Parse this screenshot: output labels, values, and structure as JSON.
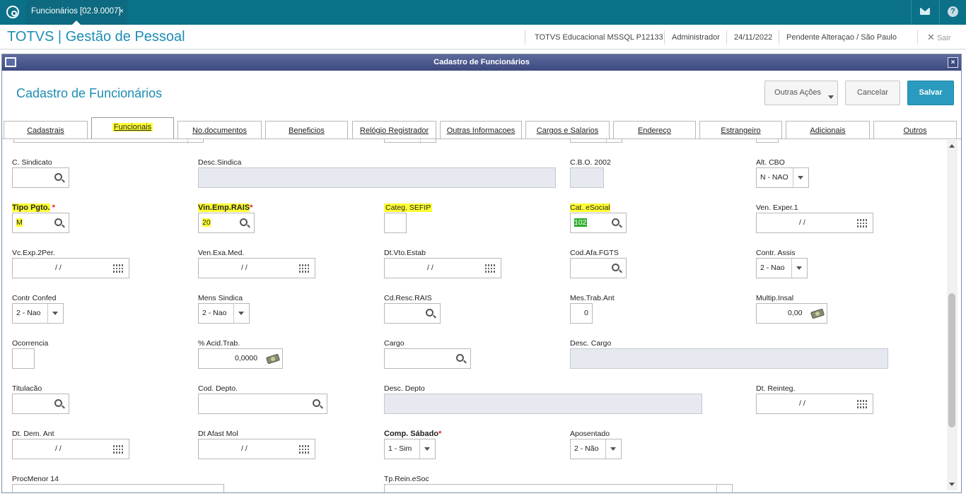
{
  "topbar": {
    "tab_label": "Funcionários [02.9.0007]",
    "tab_close": "×",
    "mail_icon": "mail-icon",
    "help_label": "?"
  },
  "header": {
    "app_title": "TOTVS | Gestão de Pessoal",
    "environment": "TOTVS Educacional MSSQL P12133",
    "user": "Administrador",
    "date": "24/11/2022",
    "status": "Pendente Alteraçao / São Paulo",
    "logout": "Sair"
  },
  "window": {
    "title": "Cadastro de Funcionários",
    "close": "×"
  },
  "form": {
    "title": "Cadastro de Funcionários",
    "actions": {
      "other": "Outras Ações",
      "cancel": "Cancelar",
      "save": "Salvar"
    }
  },
  "tabs": [
    "Cadastrais",
    "Funcionais",
    "No.documentos",
    "Beneficios",
    "Relógio Registrador",
    "Outras Informacoes",
    "Cargos e Salarios",
    "Endereço",
    "Estrangeiro",
    "Adicionais",
    "Outros"
  ],
  "fields": {
    "c_sindicato": {
      "label": "C. Sindicato"
    },
    "desc_sindica": {
      "label": "Desc.Sindica"
    },
    "cbo": {
      "label": "C.B.O. 2002"
    },
    "alt_cbo": {
      "label": "Alt. CBO",
      "value": "N - NAO"
    },
    "tipo_pgto": {
      "label": "Tipo Pgto.",
      "req": "*",
      "value": "M"
    },
    "vin_emp_rais": {
      "label": "Vin.Emp.RAIS",
      "req": "*",
      "value": "20"
    },
    "categ_sefip": {
      "label": "Categ. SEFIP"
    },
    "cat_esocial": {
      "label": "Cat. eSocial",
      "value": "102"
    },
    "ven_exper1": {
      "label": "Ven. Exper.1",
      "value": "/ /"
    },
    "vc_exp_2per": {
      "label": "Vc.Exp.2Per.",
      "value": "/ /"
    },
    "ven_exa_med": {
      "label": "Ven.Exa.Med.",
      "value": "/ /"
    },
    "dt_vto_estab": {
      "label": "Dt.Vto.Estab",
      "value": "/ /"
    },
    "cod_afa_fgts": {
      "label": "Cod.Afa.FGTS"
    },
    "contr_assis": {
      "label": "Contr. Assis",
      "value": "2 - Nao"
    },
    "contr_confed": {
      "label": "Contr Confed",
      "value": "2 - Nao"
    },
    "mens_sindica": {
      "label": "Mens Sindica",
      "value": "2 - Nao"
    },
    "cd_resc_rais": {
      "label": "Cd.Resc.RAIS"
    },
    "mes_trab_ant": {
      "label": "Mes.Trab.Ant",
      "value": "0"
    },
    "multip_insal": {
      "label": "Multip.Insal",
      "value": "0,00"
    },
    "ocorrencia": {
      "label": "Ocorrencia"
    },
    "acid_trab": {
      "label": "% Acid.Trab.",
      "value": "0,0000"
    },
    "cargo": {
      "label": "Cargo"
    },
    "desc_cargo": {
      "label": "Desc. Cargo"
    },
    "titulacao": {
      "label": "Titulacão"
    },
    "cod_depto": {
      "label": "Cod. Depto."
    },
    "desc_depto": {
      "label": "Desc. Depto"
    },
    "dt_reinteg": {
      "label": "Dt. Reinteg.",
      "value": "/ /"
    },
    "dt_dem_ant": {
      "label": "Dt. Dem. Ant",
      "value": "/ /"
    },
    "dt_afast_mol": {
      "label": "Dt Afast Mol",
      "value": "/ /"
    },
    "comp_sabado": {
      "label": "Comp. Sábado",
      "req": "*",
      "value": "1 - Sim"
    },
    "aposentado": {
      "label": "Aposentado",
      "value": "2 - Não"
    },
    "procmenor14": {
      "label": "ProcMenor 14"
    },
    "tp_rein_esoc": {
      "label": "Tp.Rein.eSoc"
    }
  },
  "colors": {
    "topbar": "#0b7189",
    "accent": "#1d8db3",
    "highlight": "#ffff33",
    "window_title": "#3d4a80",
    "save_button": "#2a9bbe"
  }
}
